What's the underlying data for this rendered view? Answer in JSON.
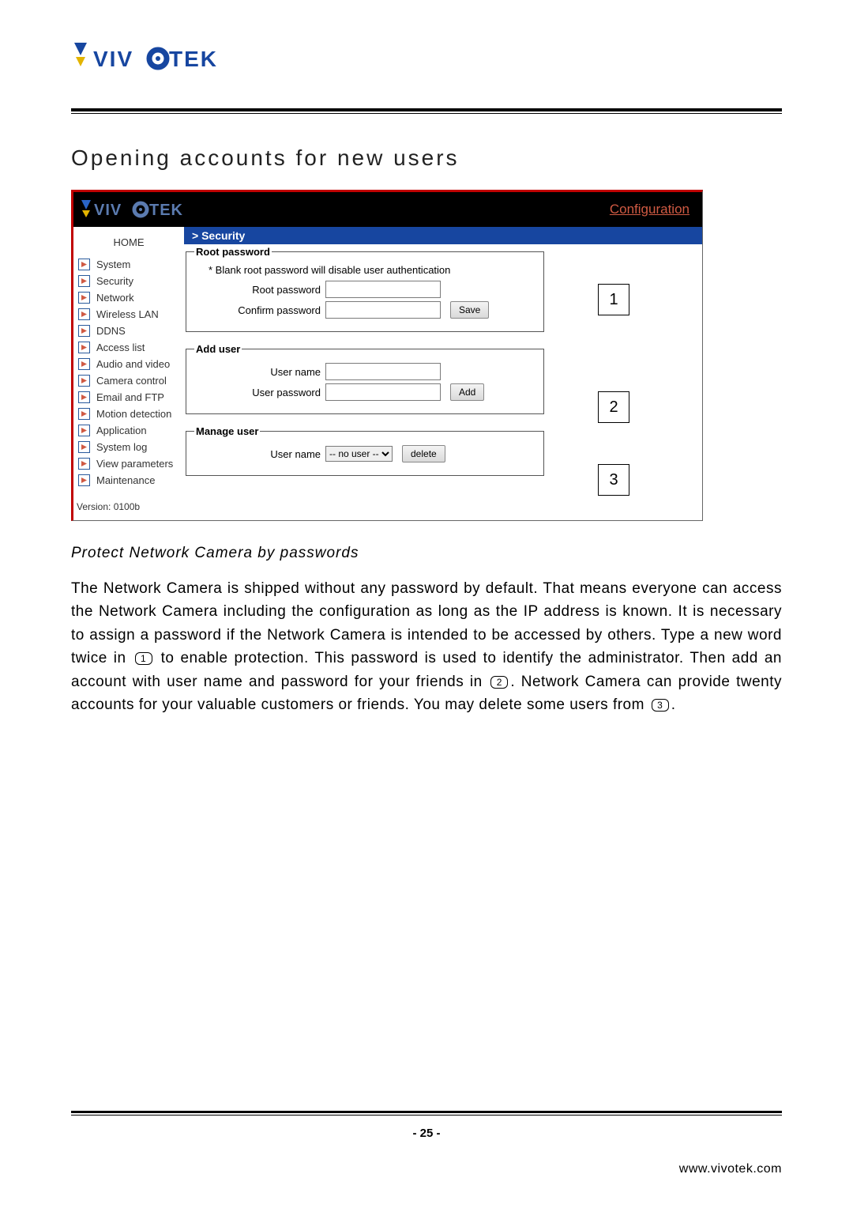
{
  "heading": "Opening accounts for new users",
  "conf_link": "Configuration",
  "crumb": "> Security",
  "sidebar": {
    "home": "HOME",
    "items": [
      "System",
      "Security",
      "Network",
      "Wireless LAN",
      "DDNS",
      "Access list",
      "Audio and video",
      "Camera control",
      "Email and FTP",
      "Motion detection",
      "Application",
      "System log",
      "View parameters",
      "Maintenance"
    ],
    "version": "Version: 0100b"
  },
  "panel1": {
    "legend": "Root password",
    "note": "* Blank root password will disable user authentication",
    "label_root": "Root password",
    "label_conf": "Confirm password",
    "save": "Save"
  },
  "panel2": {
    "legend": "Add user",
    "label_user": "User name",
    "label_pass": "User password",
    "add": "Add"
  },
  "panel3": {
    "legend": "Manage user",
    "label_user": "User name",
    "select": "-- no user --",
    "delete": "delete"
  },
  "callouts": {
    "c1": "1",
    "c2": "2",
    "c3": "3"
  },
  "subhead": "Protect Network Camera by passwords",
  "para_parts": {
    "p1": "The Network Camera is shipped without any password by default. That means everyone can access the Network Camera including the configuration as long as the IP address is known. It is necessary to assign a password if the Network Camera is intended to be accessed by others. Type a new word twice in ",
    "p2": " to enable protection. This password is used to identify the administrator. Then add an account with user name and password for your friends in ",
    "p3": ". Network Camera can provide twenty accounts for your valuable customers or friends. You may delete some users from ",
    "p4": "."
  },
  "circ": {
    "a": "1",
    "b": "2",
    "c": "3"
  },
  "page_num": "- 25 -",
  "site": "www.vivotek.com"
}
